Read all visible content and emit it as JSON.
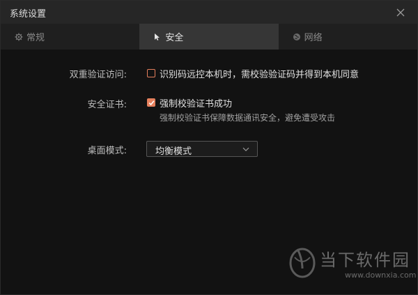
{
  "window": {
    "title": "系统设置"
  },
  "tabs": [
    {
      "label": "常规",
      "icon": "gear-icon",
      "active": false
    },
    {
      "label": "安全",
      "icon": "cursor-icon",
      "active": true
    },
    {
      "label": "网络",
      "icon": "globe-icon",
      "active": false
    }
  ],
  "security": {
    "two_factor": {
      "label": "双重验证访问:",
      "option": "识别码远控本机时，需校验验证码并得到本机同意",
      "checked": false
    },
    "certificate": {
      "label": "安全证书:",
      "option": "强制校验证书成功",
      "description": "强制校验证书保障数据通讯安全，避免遭受攻击",
      "checked": true
    },
    "desktop_mode": {
      "label": "桌面模式:",
      "value": "均衡模式"
    }
  },
  "watermark": {
    "name": "当下软件园",
    "url": "www.downxia.com"
  },
  "colors": {
    "accent": "#e6805d",
    "background": "#121212",
    "titlebar": "#262626",
    "tab_active": "#363636"
  }
}
